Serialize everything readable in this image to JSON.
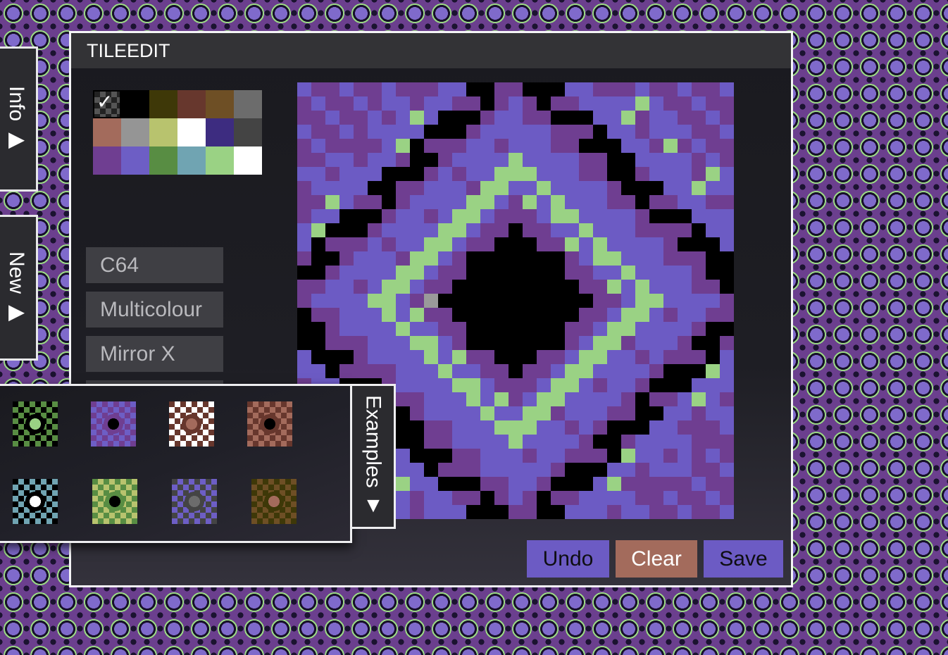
{
  "side_tabs": {
    "info": "Info ▶",
    "new": "New ▶"
  },
  "window": {
    "title": "TILEEDIT"
  },
  "palette": {
    "selected_index": 0,
    "selected_mark": "✓",
    "colors": [
      "#000000",
      "#000000",
      "#3e3808",
      "#67372d",
      "#6e4f25",
      "#6c6c6c",
      "#a36b5c",
      "#959595",
      "#b8c36e",
      "#ffffff",
      "#3d2c80",
      "#444444",
      "#6f3e91",
      "#6d5ec5",
      "#588d43",
      "#70a4b2",
      "#9ad284",
      "#ffffff"
    ]
  },
  "options": [
    {
      "name": "option-c64",
      "label": "C64"
    },
    {
      "name": "option-multicolour",
      "label": "Multicolour"
    },
    {
      "name": "option-mirror-x",
      "label": "Mirror X"
    }
  ],
  "tile": {
    "size": 31,
    "colors": {
      "K": "#000000",
      "P": "#6f3e91",
      "B": "#6c5bc4",
      "G": "#9ad284",
      "S": "#9a9a9a"
    }
  },
  "actions": {
    "undo": "Undo",
    "clear": "Clear",
    "save": "Save",
    "undo_color": "#6c5bc4",
    "clear_color": "#a36b5c",
    "save_color": "#6c5bc4"
  },
  "examples": {
    "tab_label": "Examples ▼",
    "items": [
      {
        "name": "example-tile-green-eyes",
        "c1": "#588d43",
        "c2": "#000000",
        "c3": "#9ad284"
      },
      {
        "name": "example-tile-purple-diamond",
        "c1": "#6d5ec5",
        "c2": "#6f3e91",
        "c3": "#000000"
      },
      {
        "name": "example-tile-waves",
        "c1": "#ffffff",
        "c2": "#67372d",
        "c3": "#a36b5c"
      },
      {
        "name": "example-tile-brown-face",
        "c1": "#a36b5c",
        "c2": "#67372d",
        "c3": "#000000"
      },
      {
        "name": "example-tile-cyan-gem",
        "c1": "#70a4b2",
        "c2": "#000000",
        "c3": "#ffffff"
      },
      {
        "name": "example-tile-green-bars",
        "c1": "#b8c36e",
        "c2": "#588d43",
        "c3": "#000000"
      },
      {
        "name": "example-tile-spiral",
        "c1": "#6d5ec5",
        "c2": "#444444",
        "c3": "#6c6c6c"
      },
      {
        "name": "example-tile-brown-diamond",
        "c1": "#6e4f25",
        "c2": "#3e3808",
        "c3": "#a36b5c"
      }
    ]
  }
}
